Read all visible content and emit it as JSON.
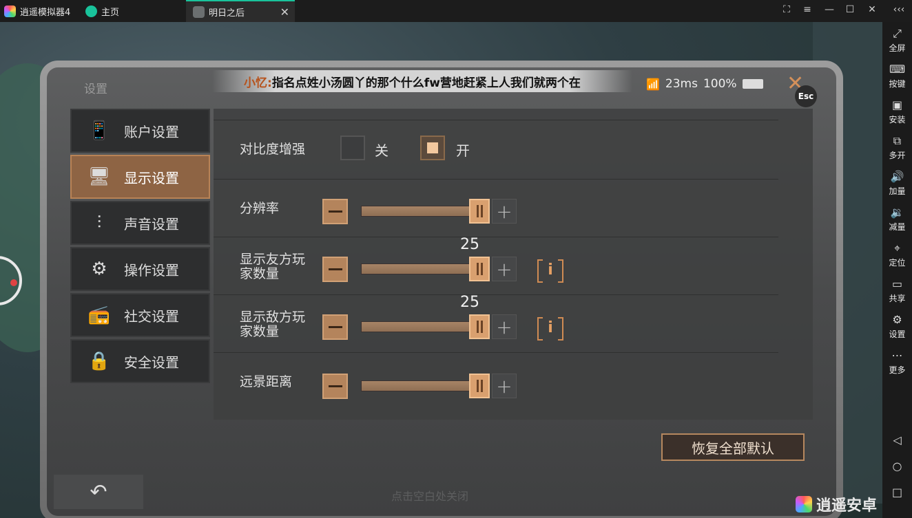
{
  "titlebar": {
    "app_name": "逍遥模拟器4",
    "tab_home": "主页",
    "tab_game": "明日之后",
    "close_glyph": "✕",
    "buttons": [
      "⛶",
      "≡",
      "—",
      "☐",
      "✕",
      "‹‹‹"
    ]
  },
  "sidebar": {
    "items": [
      {
        "label": "全屏",
        "icon": "fullscreen-icon",
        "glyph": "⤢"
      },
      {
        "label": "按键",
        "icon": "keyboard-icon",
        "glyph": "⌨"
      },
      {
        "label": "安装",
        "icon": "apk-icon",
        "glyph": "▣"
      },
      {
        "label": "多开",
        "icon": "multi-instance-icon",
        "glyph": "⧉"
      },
      {
        "label": "加量",
        "icon": "volume-up-icon",
        "glyph": "🔊"
      },
      {
        "label": "减量",
        "icon": "volume-down-icon",
        "glyph": "🔉"
      },
      {
        "label": "定位",
        "icon": "location-icon",
        "glyph": "⌖"
      },
      {
        "label": "共享",
        "icon": "folder-icon",
        "glyph": "▭"
      },
      {
        "label": "设置",
        "icon": "gear-icon",
        "glyph": "⚙"
      },
      {
        "label": "更多",
        "icon": "more-icon",
        "glyph": "⋯"
      }
    ],
    "nav_back": "◁",
    "nav_home": "○",
    "nav_recent": "□"
  },
  "game": {
    "title": "设置",
    "ticker_name": "小忆:",
    "ticker_text": "指名点姓小汤圆丫的那个什么fw营地赶紧上人我们就两个在",
    "ping": "23ms",
    "battery": "100%",
    "close_glyph": "✕",
    "esc_label": "Esc",
    "nav": [
      {
        "label": "账户设置",
        "icon": "account-icon",
        "glyph": "📱",
        "active": false
      },
      {
        "label": "显示设置",
        "icon": "display-icon",
        "glyph": "🖥",
        "active": true
      },
      {
        "label": "声音设置",
        "icon": "sound-sliders-icon",
        "glyph": "⫶",
        "active": false
      },
      {
        "label": "操作设置",
        "icon": "controls-gear-icon",
        "glyph": "⚙",
        "active": false
      },
      {
        "label": "社交设置",
        "icon": "walkie-talkie-icon",
        "glyph": "📻",
        "active": false
      },
      {
        "label": "安全设置",
        "icon": "lock-icon",
        "glyph": "🔒",
        "active": false
      }
    ],
    "contrast": {
      "label": "对比度增强",
      "off_label": "关",
      "on_label": "开",
      "value": "开"
    },
    "sliders": [
      {
        "label": "分辨率",
        "value_text": "",
        "fraction": 0.98,
        "info": false
      },
      {
        "label": "显示友方玩家数量",
        "value_text": "25",
        "fraction": 0.98,
        "info": true
      },
      {
        "label": "显示敌方玩家数量",
        "value_text": "25",
        "fraction": 0.98,
        "info": true
      },
      {
        "label": "远景距离",
        "value_text": "",
        "fraction": 0.98,
        "info": false
      }
    ],
    "info_glyph": "i",
    "minus_glyph": "—",
    "plus_glyph": "+",
    "reset_label": "恢复全部默认",
    "back_glyph": "↶",
    "hint": "点击空白处关闭"
  },
  "watermark": "逍遥安卓",
  "colors": {
    "accent": "#b4845c",
    "tab_accent": "#19c39b",
    "active_nav": "#8e6444"
  }
}
